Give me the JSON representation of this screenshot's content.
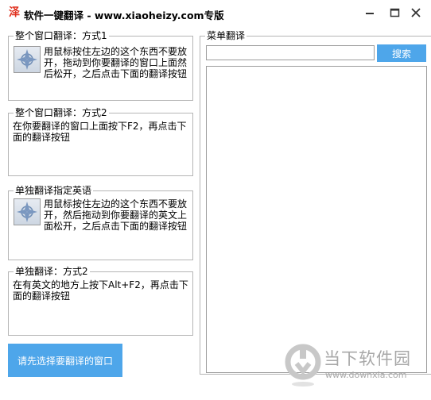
{
  "window": {
    "app_icon_glyph": "泽",
    "title": "软件一键翻译 - www.xiaoheizy.com专版",
    "minimize_icon": "minimize-icon",
    "maximize_icon": "maximize-icon",
    "close_icon": "close-icon"
  },
  "groups": [
    {
      "legend": "整个窗口翻译：方式1",
      "icon": "crosshair-drag-icon",
      "text": "用鼠标按住左边的这个东西不要放开，拖动到你要翻译的窗口上面然后松开，之后点击下面的翻译按钮"
    },
    {
      "legend": "整个窗口翻译：方式2",
      "text": "在你要翻译的窗口上面按下F2，再点击下面的翻译按钮"
    },
    {
      "legend": "单独翻译指定英语",
      "icon": "crosshair-drag-icon",
      "text": "用鼠标按住左边的这个东西不要放开，然后拖动到你要翻译的英文上面松开，之后点击下面的翻译按钮"
    },
    {
      "legend": "单独翻译：方式2",
      "text": "在有英文的地方上按下Alt+F2，再点击下面的翻译按钮"
    }
  ],
  "select_window_button": "请先选择要翻译的窗口",
  "menu_translate": {
    "legend": "菜单翻译",
    "search_value": "",
    "search_button": "搜索",
    "items": []
  },
  "watermark": {
    "name": "当下软件园",
    "url": "www.downxia.com"
  },
  "colors": {
    "accent": "#4ea6ea",
    "border": "#b5b5b5",
    "app_icon": "#e0301e"
  }
}
